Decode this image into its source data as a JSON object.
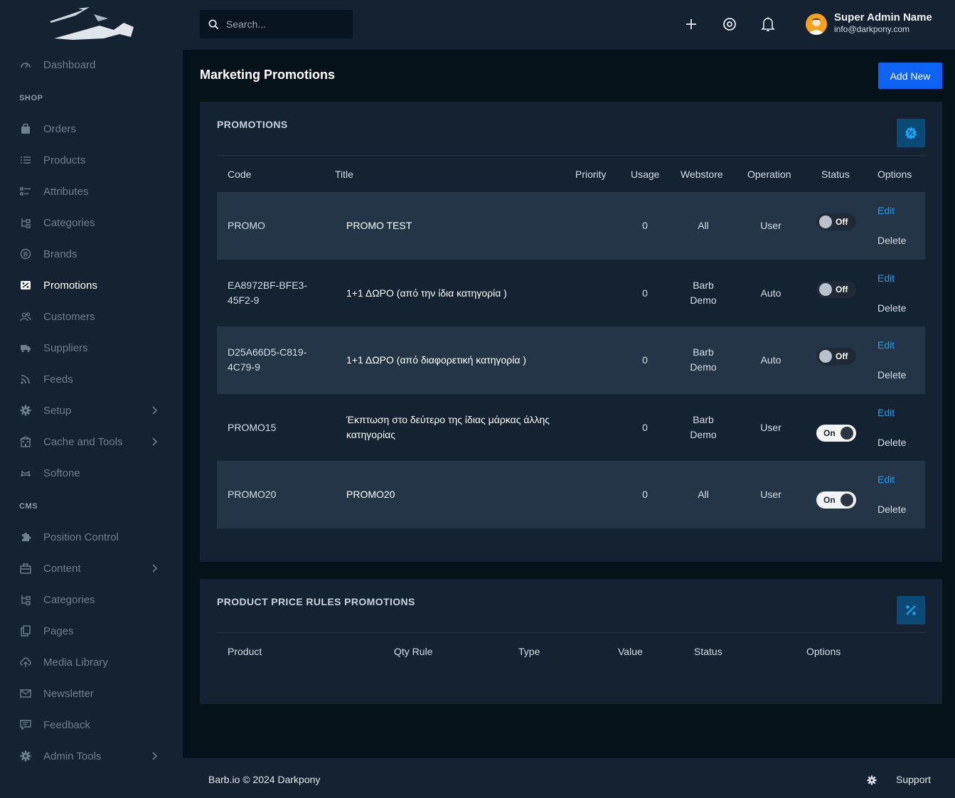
{
  "sidebar": {
    "items": [
      {
        "label": "Dashboard",
        "icon": "gauge-icon"
      },
      {
        "label": "Orders",
        "icon": "bag-icon"
      },
      {
        "label": "Products",
        "icon": "list-icon"
      },
      {
        "label": "Attributes",
        "icon": "attributes-icon"
      },
      {
        "label": "Categories",
        "icon": "tree-icon"
      },
      {
        "label": "Brands",
        "icon": "brand-icon"
      },
      {
        "label": "Promotions",
        "icon": "percent-tag-icon"
      },
      {
        "label": "Customers",
        "icon": "users-icon"
      },
      {
        "label": "Suppliers",
        "icon": "truck-icon"
      },
      {
        "label": "Feeds",
        "icon": "rss-icon"
      },
      {
        "label": "Setup",
        "icon": "gear-icon"
      },
      {
        "label": "Cache and Tools",
        "icon": "building-icon"
      },
      {
        "label": "Softone",
        "icon": "bridge-icon"
      },
      {
        "label": "Position Control",
        "icon": "puzzle-icon"
      },
      {
        "label": "Content",
        "icon": "briefcase-icon"
      },
      {
        "label": "Categories",
        "icon": "tree-icon"
      },
      {
        "label": "Pages",
        "icon": "pages-icon"
      },
      {
        "label": "Media Library",
        "icon": "cloud-upload-icon"
      },
      {
        "label": "Newsletter",
        "icon": "envelope-icon"
      },
      {
        "label": "Feedback",
        "icon": "comment-icon"
      },
      {
        "label": "Admin Tools",
        "icon": "gear-icon"
      }
    ],
    "section_shop": "SHOP",
    "section_cms": "CMS",
    "active": "Promotions"
  },
  "topbar": {
    "search_placeholder": "Search...",
    "user_name": "Super Admin Name",
    "user_email": "info@darkpony.com"
  },
  "page": {
    "title": "Marketing Promotions",
    "add_new_label": "Add New"
  },
  "promotions": {
    "card_title": "PROMOTIONS",
    "columns": [
      "Code",
      "Title",
      "Priority",
      "Usage",
      "Webstore",
      "Operation",
      "Status",
      "Options"
    ],
    "edit_label": "Edit",
    "delete_label": "Delete",
    "rows": [
      {
        "code": "PROMO",
        "title": "PROMO TEST",
        "priority": "",
        "usage": "0",
        "webstore": "All",
        "operation": "User",
        "status": "Off"
      },
      {
        "code": "EA8972BF-BFE3-45F2-9",
        "title": "1+1 ΔΩΡΟ (από την ίδια κατηγορία )",
        "priority": "",
        "usage": "0",
        "webstore": "Barb Demo",
        "operation": "Auto",
        "status": "Off"
      },
      {
        "code": "D25A66D5-C819-4C79-9",
        "title": "1+1 ΔΩΡΟ (από διαφορετική κατηγορία )",
        "priority": "",
        "usage": "0",
        "webstore": "Barb Demo",
        "operation": "Auto",
        "status": "Off"
      },
      {
        "code": "PROMO15",
        "title": "Έκπτωση στο δεύτερο της ίδιας μάρκας άλλης κατηγορίας",
        "priority": "",
        "usage": "0",
        "webstore": "Barb Demo",
        "operation": "User",
        "status": "On"
      },
      {
        "code": "PROMO20",
        "title": "PROMO20",
        "priority": "",
        "usage": "0",
        "webstore": "All",
        "operation": "User",
        "status": "On"
      }
    ]
  },
  "price_rules": {
    "card_title": "PRODUCT PRICE RULES PROMOTIONS",
    "columns": [
      "Product",
      "Qty Rule",
      "Type",
      "Value",
      "Status",
      "Options"
    ]
  },
  "footer": {
    "copyright": "Barb.io © 2024 Darkpony",
    "support_label": "Support"
  },
  "colors": {
    "accent": "#0d63f3",
    "link": "#1ea1f2",
    "sidebar_bg": "#152231",
    "page_bg": "#06121a"
  }
}
